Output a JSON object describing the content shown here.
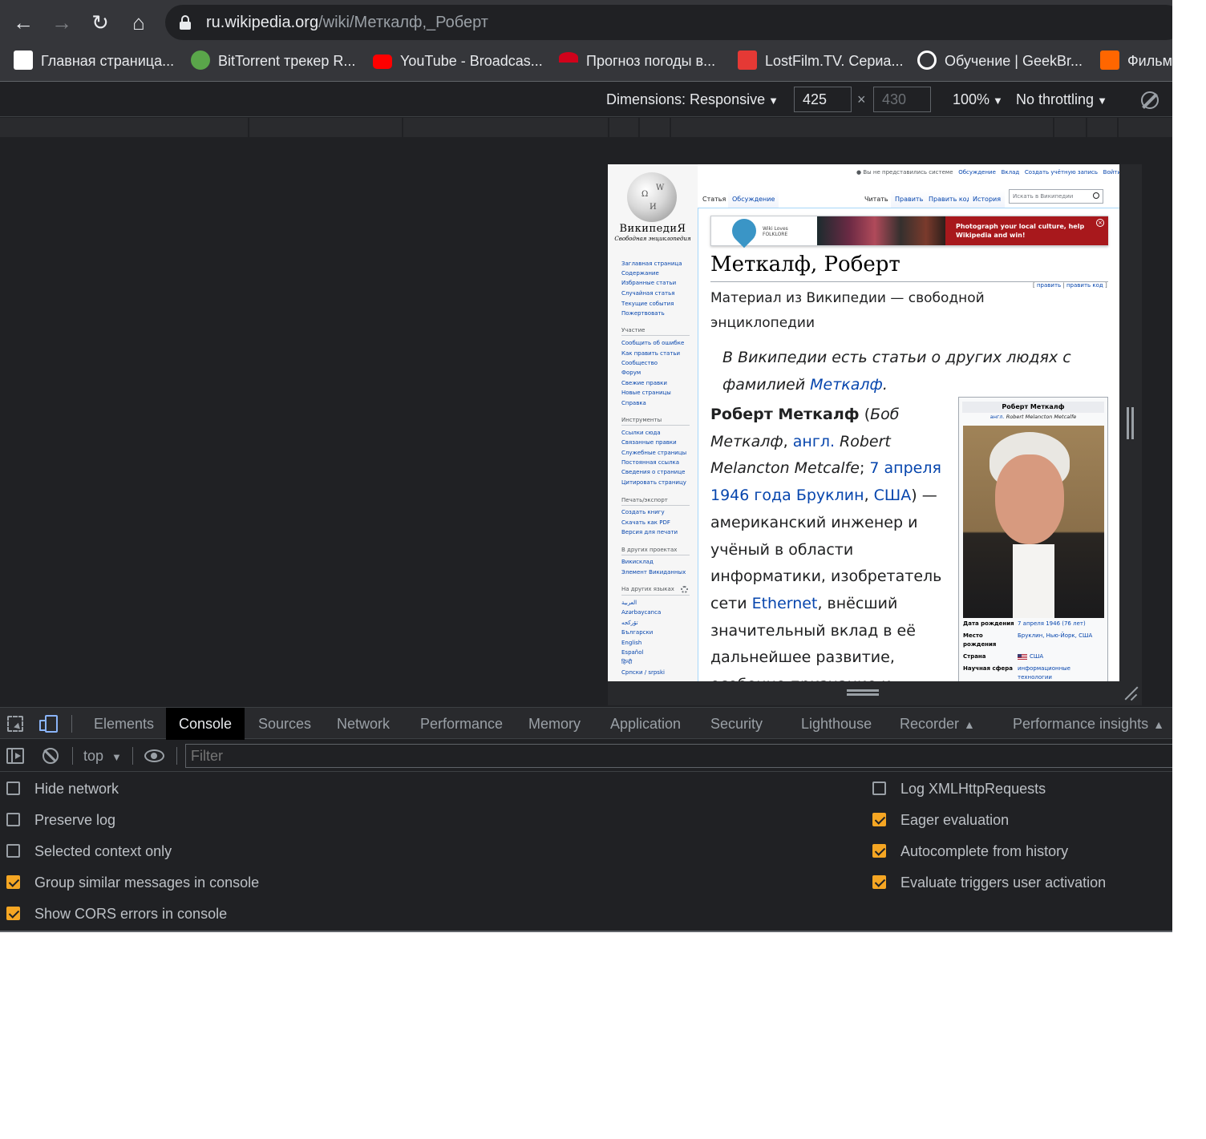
{
  "browser": {
    "url_host": "ru.wikipedia.org",
    "url_path": "/wiki/Меткалф,_Роберт",
    "bookmarks": [
      {
        "label": "Главная страница...",
        "icon": "grid-favicon",
        "color": "#ffffff"
      },
      {
        "label": "BitTorrent трекер R...",
        "icon": "rutracker-favicon",
        "color": "#e04545"
      },
      {
        "label": "YouTube - Broadcas...",
        "icon": "youtube-favicon",
        "color": "#ff0000"
      },
      {
        "label": "Прогноз погоды в...",
        "icon": "umbrella-favicon",
        "color": "#d0021b"
      },
      {
        "label": "LostFilm.TV. Сериа...",
        "icon": "lostfilm-favicon",
        "color": "#e53935"
      },
      {
        "label": "Обучение | GeekBr...",
        "icon": "geekbrains-favicon",
        "color": "#ffffff"
      },
      {
        "label": "Фильм",
        "icon": "kinopoisk-favicon",
        "color": "#ff6600"
      }
    ]
  },
  "device_toolbar": {
    "dimensions": "Dimensions: Responsive",
    "width": "425",
    "height": "430",
    "times": "×",
    "zoom": "100%",
    "throttling": "No throttling"
  },
  "wiki": {
    "logo_name": "ВикипедиЯ",
    "logo_tagline": "Свободная энциклопедия",
    "personal": {
      "anon": "Вы не представились системе",
      "talk": "Обсуждение",
      "contrib": "Вклад",
      "create": "Создать учётную запись",
      "login": "Войти"
    },
    "tabs": {
      "article": "Статья",
      "discussion": "Обсуждение",
      "read": "Читать",
      "edit": "Править",
      "edit_source": "Править код",
      "history": "История"
    },
    "search_placeholder": "Искать в Википедии",
    "nav": [
      "Заглавная страница",
      "Содержание",
      "Избранные статьи",
      "Случайная статья",
      "Текущие события",
      "Пожертвовать"
    ],
    "participate_head": "Участие",
    "participate": [
      "Сообщить об ошибке",
      "Как править статьи",
      "Сообщество",
      "Форум",
      "Свежие правки",
      "Новые страницы",
      "Справка"
    ],
    "tools_head": "Инструменты",
    "tools": [
      "Ссылки сюда",
      "Связанные правки",
      "Служебные страницы",
      "Постоянная ссылка",
      "Сведения о странице",
      "Цитировать страницу"
    ],
    "print_head": "Печать/экспорт",
    "print": [
      "Создать книгу",
      "Скачать как PDF",
      "Версия для печати"
    ],
    "projects_head": "В других проектах",
    "projects": [
      "Викисклад",
      "Элемент Викиданных"
    ],
    "langs_head": "На других языках",
    "langs": [
      "العربية",
      "Azərbaycanca",
      "تۆرکجه",
      "Български",
      "English",
      "Español",
      "हिन्दी",
      "Српски / srpski"
    ],
    "banner": {
      "logo_line1": "Wiki Loves",
      "logo_line2": "FOLKLORE",
      "text": "Photograph your local culture, help Wikipedia and win!",
      "close": "×"
    },
    "title": "Меткалф, Роберт",
    "edit_links": {
      "open": "[ ",
      "edit": "править",
      "sep": " | ",
      "edit_code": "править код",
      "close": " ]"
    },
    "subtitle": "Материал из Википедии — свободной энциклопедии",
    "hatnote_prefix": "В Википедии есть статьи о других людях с фамилией ",
    "hatnote_link": "Меткалф",
    "hatnote_suffix": ".",
    "lead": {
      "name": "Роберт Меткалф",
      "p1": " (",
      "alt_name": "Боб Меткалф",
      "comma": ", ",
      "lang": "англ.",
      "space": " ",
      "orig": "Robert Melancton Metcalfe",
      "semicolon": "; ",
      "birth_date": "7 апреля 1946 года",
      "space2": " ",
      "birth_place": "Бруклин",
      "comma2": ", ",
      "country": "США",
      "p2": ") — американский инженер и учёный в области информатики, изобретатель сети ",
      "ethernet": "Ethernet",
      "p3": ", внёсший значительный вклад в её дальнейшее развитие, особенно признание и"
    },
    "infobox": {
      "title": "Роберт Меткалф",
      "orig_lang": "англ.",
      "orig_name": "Robert Melancton Metcalfe",
      "rows": [
        {
          "label": "Дата рождения",
          "value": "7 апреля 1946 (76 лет)"
        },
        {
          "label": "Место рождения",
          "value": "Бруклин, Нью-Йорк, США"
        },
        {
          "label": "Страна",
          "value": "США"
        },
        {
          "label": "Научная сфера",
          "value": "информационные технологии"
        }
      ]
    }
  },
  "devtools": {
    "tabs": [
      "Elements",
      "Console",
      "Sources",
      "Network",
      "Performance",
      "Memory",
      "Application",
      "Security",
      "Lighthouse",
      "Recorder",
      "Performance insights"
    ],
    "active_tab": "Console",
    "context": "top",
    "filter_placeholder": "Filter",
    "settings_left": [
      {
        "label": "Hide network",
        "checked": false
      },
      {
        "label": "Preserve log",
        "checked": false
      },
      {
        "label": "Selected context only",
        "checked": false
      },
      {
        "label": "Group similar messages in console",
        "checked": true
      },
      {
        "label": "Show CORS errors in console",
        "checked": true
      }
    ],
    "settings_right": [
      {
        "label": "Log XMLHttpRequests",
        "checked": false
      },
      {
        "label": "Eager evaluation",
        "checked": true
      },
      {
        "label": "Autocomplete from history",
        "checked": true
      },
      {
        "label": "Evaluate triggers user activation",
        "checked": true
      }
    ]
  }
}
